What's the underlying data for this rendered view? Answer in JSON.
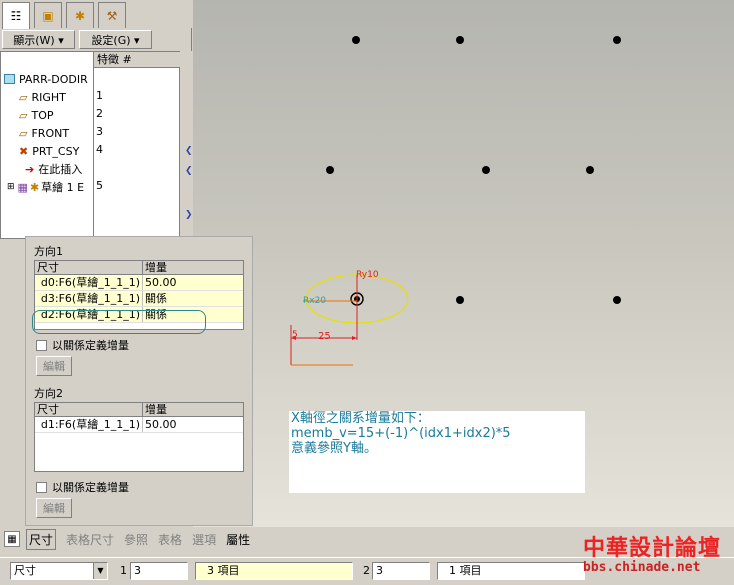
{
  "model_tree": {
    "tabs": [
      "model-tree-tab",
      "layer-tab",
      "favorites-tab",
      "tools-tab"
    ],
    "show_label": "顯示(W) ▾",
    "settings_label": "設定(G) ▾",
    "column_header": "特徵 #",
    "items": [
      {
        "label": "PARR-DODIR",
        "num": ""
      },
      {
        "label": "RIGHT",
        "num": "1"
      },
      {
        "label": "TOP",
        "num": "2"
      },
      {
        "label": "FRONT",
        "num": "3"
      },
      {
        "label": "PRT_CSY",
        "num": "4"
      },
      {
        "label": "在此插入",
        "num": ""
      },
      {
        "label": "草繪 1 E",
        "num": "5"
      }
    ]
  },
  "pattern_dialog": {
    "dir1_title": "方向1",
    "col_dim": "尺寸",
    "col_inc": "增量",
    "dir1_rows": [
      {
        "dim": "d0:F6(草繪_1_1_1)",
        "inc": "50.00"
      },
      {
        "dim": "d3:F6(草繪_1_1_1)",
        "inc": "關係"
      },
      {
        "dim": "d2:F6(草繪_1_1_1)",
        "inc": "關係"
      }
    ],
    "relation_checkbox": "以關係定義增量",
    "edit_button": "編輯",
    "dir2_title": "方向2",
    "dir2_rows": [
      {
        "dim": "d1:F6(草繪_1_1_1)",
        "inc": "50.00"
      }
    ]
  },
  "sketch": {
    "ry_label": "Ry10",
    "rx_label": "Rx20",
    "dim_25": "25",
    "dim_5": "5"
  },
  "note": {
    "line1": "X軸徑之關系增量如下：",
    "line2": "memb_v=15+(-1)^(idx1+idx2)*5",
    "line3": "意義參照Y軸。"
  },
  "bottom_tabs": [
    "尺寸",
    "表格尺寸",
    "參照",
    "表格",
    "選項",
    "屬性"
  ],
  "status": {
    "select_value": "尺寸",
    "n1_label": "1",
    "n1_value": "3",
    "items1": "3 項目",
    "n2_label": "2",
    "n2_value": "3",
    "items2": "1 項目"
  },
  "watermark": {
    "title": "中華設計論壇",
    "url": "bbs.chinade.net"
  },
  "colors": {
    "sketch_yellow": "#e8e000",
    "dim_orange": "#f07000",
    "dim_red": "#e02020",
    "cyan": "#2aa0b0"
  }
}
